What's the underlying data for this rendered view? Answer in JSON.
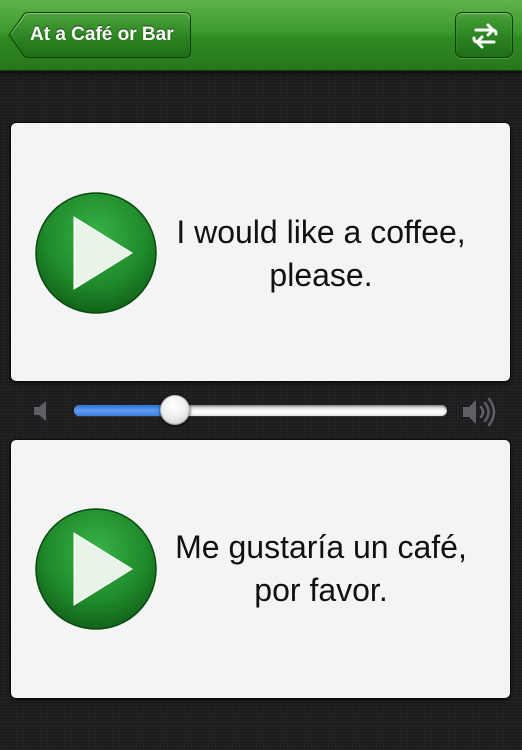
{
  "navbar": {
    "back_label": "At a Café or Bar",
    "switch_icon": "swap-arrows-icon"
  },
  "cards": [
    {
      "phrase": "I would like a coffee, please.",
      "play_icon": "play-icon"
    },
    {
      "phrase": "Me gustaría un café, por favor.",
      "play_icon": "play-icon"
    }
  ],
  "volume": {
    "level": 0.27,
    "min_icon": "speaker-low-icon",
    "max_icon": "speaker-high-icon"
  },
  "colors": {
    "navbar_green": "#2f8a22",
    "play_green": "#1f8a2a",
    "slider_blue": "#3f7fdd",
    "card_bg": "#f4f4f4"
  }
}
